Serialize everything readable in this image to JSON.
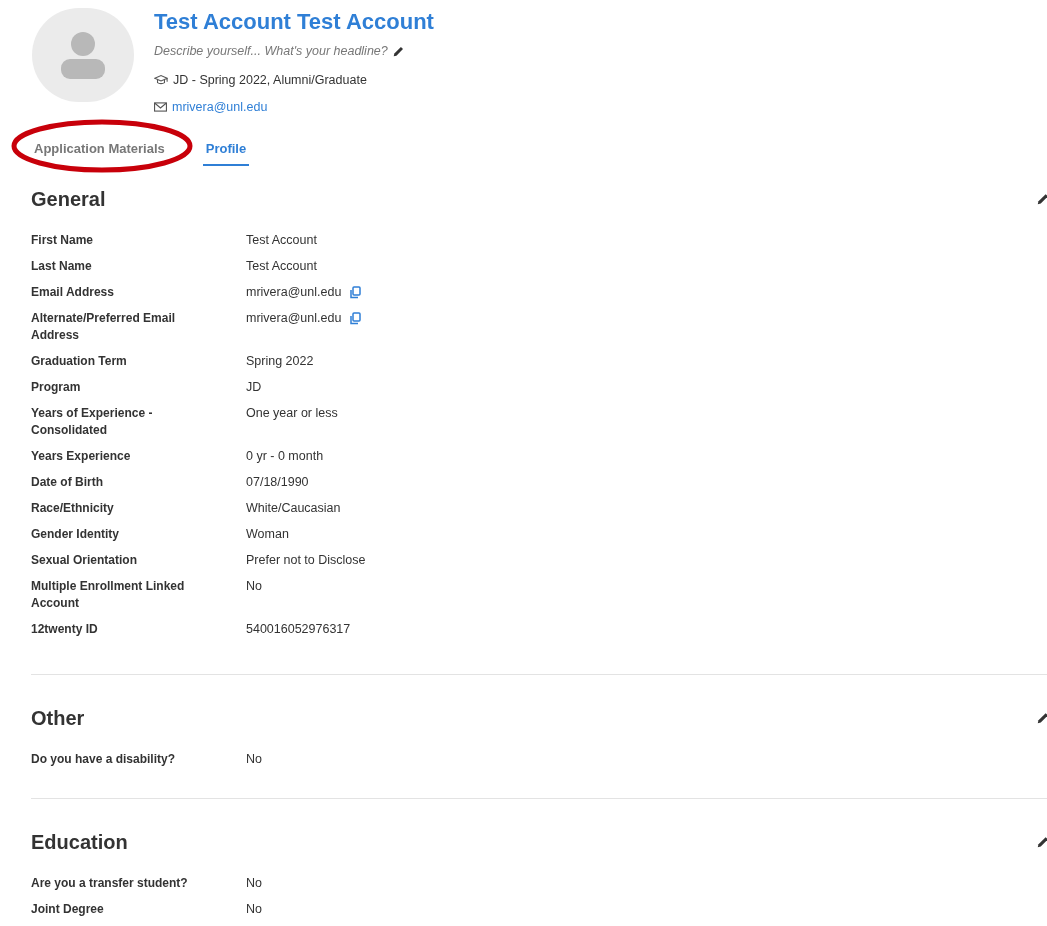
{
  "profile": {
    "name": "Test Account Test Account",
    "headline": "Describe yourself... What's your headline?",
    "program": "JD - Spring 2022, Alumni/Graduate",
    "email": "mrivera@unl.edu"
  },
  "tabs": [
    {
      "label": "Application Materials",
      "selected": false,
      "circled": true
    },
    {
      "label": "Profile",
      "selected": true,
      "circled": false
    }
  ],
  "sections": [
    {
      "title": "General",
      "rows": [
        {
          "label": "First Name",
          "value": "Test Account",
          "copyable": false
        },
        {
          "label": "Last Name",
          "value": "Test Account",
          "copyable": false
        },
        {
          "label": "Email Address",
          "value": "mrivera@unl.edu",
          "copyable": true
        },
        {
          "label": "Alternate/Preferred Email Address",
          "value": "mrivera@unl.edu",
          "copyable": true
        },
        {
          "label": "Graduation Term",
          "value": "Spring 2022",
          "copyable": false
        },
        {
          "label": "Program",
          "value": "JD",
          "copyable": false
        },
        {
          "label": "Years of Experience - Consolidated",
          "value": "One year or less",
          "copyable": false
        },
        {
          "label": "Years Experience",
          "value": "0 yr - 0 month",
          "copyable": false
        },
        {
          "label": "Date of Birth",
          "value": "07/18/1990",
          "copyable": false
        },
        {
          "label": "Race/Ethnicity",
          "value": "White/Caucasian",
          "copyable": false
        },
        {
          "label": "Gender Identity",
          "value": "Woman",
          "copyable": false
        },
        {
          "label": "Sexual Orientation",
          "value": "Prefer not to Disclose",
          "copyable": false
        },
        {
          "label": "Multiple Enrollment Linked Account",
          "value": "No",
          "copyable": false
        },
        {
          "label": "12twenty ID",
          "value": "540016052976317",
          "copyable": false
        }
      ]
    },
    {
      "title": "Other",
      "rows": [
        {
          "label": "Do you have a disability?",
          "value": "No",
          "copyable": false
        }
      ]
    },
    {
      "title": "Education",
      "rows": [
        {
          "label": "Are you a transfer student?",
          "value": "No",
          "copyable": false
        },
        {
          "label": "Joint Degree",
          "value": "No",
          "copyable": false
        }
      ]
    }
  ]
}
